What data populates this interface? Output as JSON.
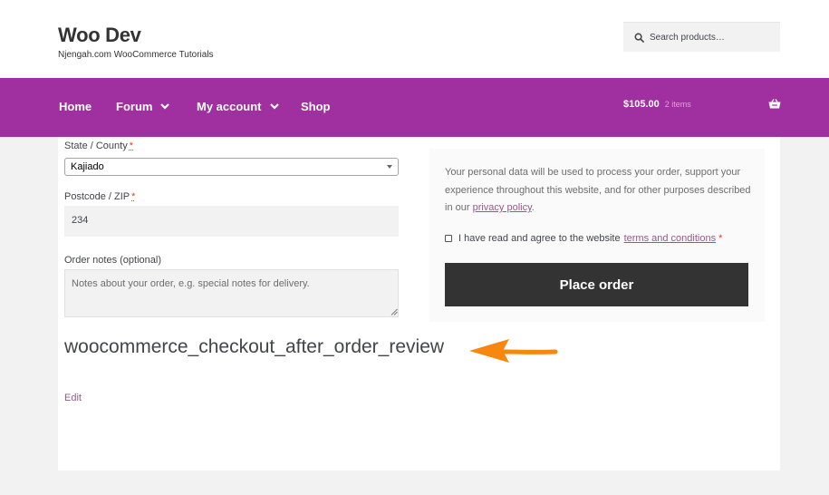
{
  "site": {
    "title": "Woo Dev",
    "tagline": "Njengah.com WooCommerce Tutorials"
  },
  "search": {
    "placeholder": "Search products…"
  },
  "nav": {
    "items": [
      {
        "label": "Home",
        "has_dropdown": false
      },
      {
        "label": "Forum",
        "has_dropdown": true
      },
      {
        "label": "My account",
        "has_dropdown": true
      },
      {
        "label": "Shop",
        "has_dropdown": false
      }
    ]
  },
  "cart": {
    "total": "$105.00",
    "count": "2 items"
  },
  "form": {
    "state_label": "State / County",
    "state_value": "Kajiado",
    "postcode_label": "Postcode / ZIP",
    "postcode_value": "234",
    "notes_label": "Order notes (optional)",
    "notes_placeholder": "Notes about your order, e.g. special notes for delivery.",
    "required_mark": "*"
  },
  "review": {
    "privacy_text_before": "Your personal data will be used to process your order, support your experience throughout this website, and for other purposes described in our ",
    "privacy_link": "privacy policy",
    "privacy_text_after": ".",
    "terms_text": "I have read and agree to the website",
    "terms_link": "terms and conditions",
    "terms_required": "*",
    "place_order_label": "Place order"
  },
  "annotation": {
    "hook_name": "woocommerce_checkout_after_order_review",
    "arrow_color": "#f7870f"
  },
  "edit_link": "Edit",
  "colors": {
    "nav_bg": "#a0309f",
    "button_bg": "#333333",
    "link": "#96588a",
    "required": "#e2401c"
  }
}
